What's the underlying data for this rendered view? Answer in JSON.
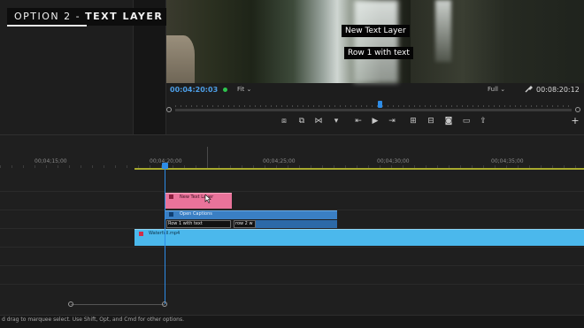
{
  "title_overlay": {
    "prefix": "OPTION 2 - ",
    "bold": "TEXT LAYER"
  },
  "program_monitor": {
    "caption_line1": "New Text Layer",
    "caption_line2": "Row 1 with text",
    "current_timecode": "00:04:20:03",
    "fit_label": "Fit",
    "resolution_label": "Full",
    "duration_timecode": "00:08:20:12"
  },
  "transport_icons": [
    "marker-in-icon",
    "marker-out-icon",
    "trim-icon",
    "add-marker-icon",
    "go-to-in-icon",
    "play-icon",
    "go-to-out-icon",
    "insert-icon",
    "overwrite-icon",
    "export-frame-icon",
    "safe-margins-icon",
    "share-icon",
    "add-button-icon"
  ],
  "timeline": {
    "ruler_labels": [
      "00;04;15;00",
      "00;04;20;00",
      "00;04;25;00",
      "00;04;30;00",
      "00;04;35;00"
    ],
    "clips": {
      "text_layer": "New Text Layer",
      "open_captions": "Open Captions",
      "caption_1": "Row 1 with text",
      "caption_2": "row 2 w",
      "video": "Waterfall.mp4"
    }
  },
  "status_bar": {
    "text": "d drag to marquee select. Use Shift, Opt, and Cmd for other options."
  },
  "colors": {
    "accent_blue": "#2d8ce6",
    "text_clip": "#e9739a",
    "caption_clip": "#3a7fc4",
    "video_clip": "#4bb8ec",
    "work_area": "#a7a92e"
  }
}
